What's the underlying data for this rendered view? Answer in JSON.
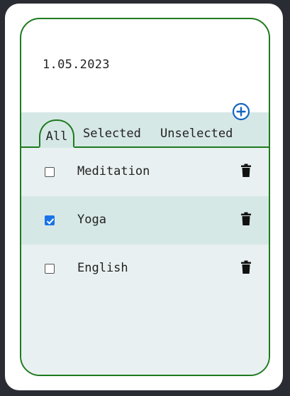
{
  "date": "1.05.2023",
  "tabs": {
    "all": "All",
    "selected": "Selected",
    "unselected": "Unselected"
  },
  "active_tab": "all",
  "items": [
    {
      "label": "Meditation",
      "checked": false
    },
    {
      "label": "Yoga",
      "checked": true
    },
    {
      "label": "English",
      "checked": false
    }
  ],
  "icons": {
    "add": "plus-circle-icon",
    "delete": "trash-icon",
    "check": "checkmark-icon"
  },
  "colors": {
    "accent_green": "#1e7a1e",
    "checkbox_blue": "#1a73e8",
    "add_blue": "#1565c0",
    "tab_bg": "#d6e8e6",
    "list_bg": "#e9f0f1"
  }
}
